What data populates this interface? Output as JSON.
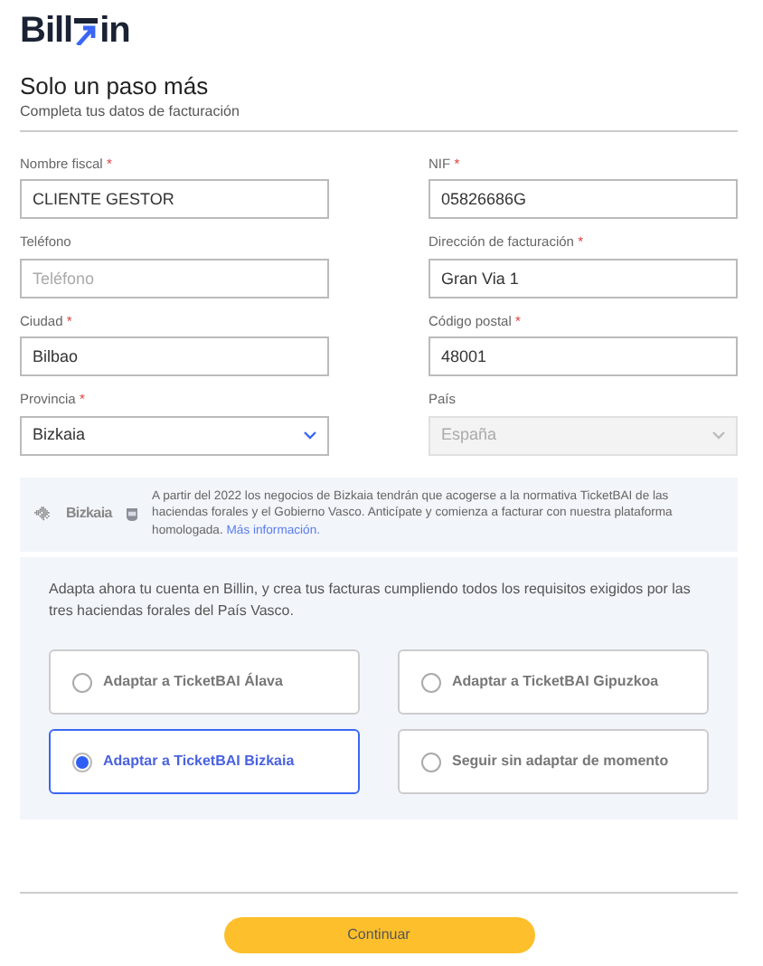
{
  "logo": {
    "text_before": "Bill",
    "text_after": "in"
  },
  "header": {
    "title": "Solo un paso más",
    "subtitle": "Completa tus datos de facturación"
  },
  "fields": [
    {
      "kind": "text",
      "label": "Nombre fiscal",
      "required_mark": "*",
      "value": "CLIENTE GESTOR",
      "disabled": false
    },
    {
      "kind": "text",
      "label": "NIF",
      "required_mark": "*",
      "value": "05826686G",
      "disabled": false
    },
    {
      "kind": "text",
      "label": "Teléfono",
      "placeholder": "Teléfono",
      "disabled": false
    },
    {
      "kind": "text",
      "label": "Dirección de facturación",
      "required_mark": "*",
      "value": "Gran Via 1",
      "disabled": false
    },
    {
      "kind": "text",
      "label": "Ciudad",
      "required_mark": "*",
      "value": "Bilbao",
      "disabled": false
    },
    {
      "kind": "text",
      "label": "Código postal",
      "required_mark": "*",
      "value": "48001",
      "disabled": false
    },
    {
      "kind": "select",
      "label": "Provincia",
      "required_mark": "*",
      "value": "Bizkaia",
      "disabled": false
    },
    {
      "kind": "select",
      "label": "País",
      "value": "España",
      "disabled": true
    }
  ],
  "notice": {
    "logo_text": "Bizkaia",
    "text": "A partir del 2022 los negocios de Bizkaia tendrán que acogerse a la normativa TicketBAI de las haciendas forales y el Gobierno Vasco. Anticípate y comienza a facturar con nuestra plataforma homologada.",
    "link": "Más información."
  },
  "adapt": {
    "intro": "Adapta ahora tu cuenta en Billin, y crea tus facturas cumpliendo todos los requisitos exigidos por las tres haciendas forales del País Vasco.",
    "options": [
      {
        "label": "Adaptar a TicketBAI Álava",
        "selected": false
      },
      {
        "label": "Adaptar a TicketBAI Gipuzkoa",
        "selected": false
      },
      {
        "label": "Adaptar a TicketBAI Bizkaia",
        "selected": true
      },
      {
        "label": "Seguir sin adaptar de momento",
        "selected": false
      }
    ]
  },
  "submit": {
    "label": "Continuar"
  }
}
